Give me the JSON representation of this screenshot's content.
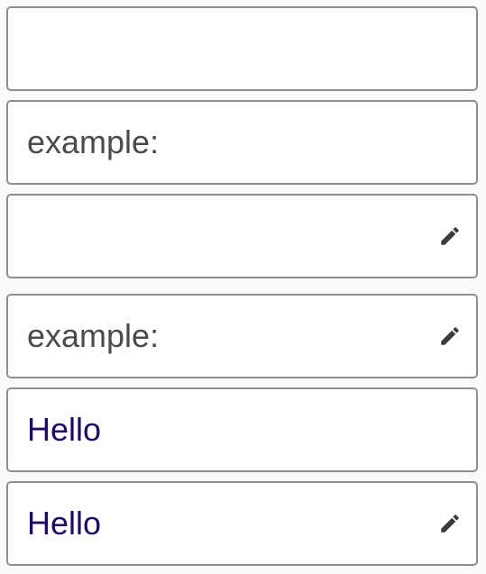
{
  "fields": [
    {
      "placeholder": "",
      "value": "",
      "icon": ""
    },
    {
      "placeholder": "example:",
      "value": "",
      "icon": ""
    },
    {
      "placeholder": "",
      "value": "",
      "icon": "pencil-icon"
    },
    {
      "placeholder": "example:",
      "value": "",
      "icon": "pencil-icon"
    },
    {
      "placeholder": "",
      "value": "Hello",
      "icon": ""
    },
    {
      "placeholder": "",
      "value": "Hello",
      "icon": "pencil-icon"
    }
  ],
  "colors": {
    "border": "#8e8e8e",
    "placeholder": "#4a4a4f",
    "value_text": "#1f0a63",
    "icon": "#3b3b3b",
    "background": "#fafafa"
  }
}
